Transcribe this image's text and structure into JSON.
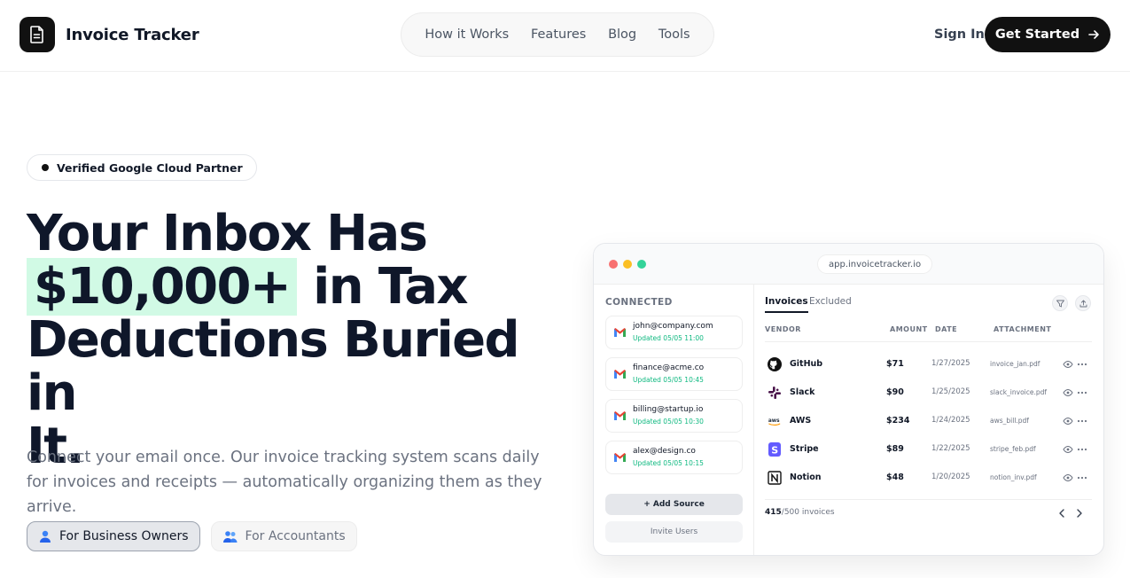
{
  "brand": {
    "name": "Invoice Tracker",
    "icon": "document-icon"
  },
  "nav": {
    "items": [
      "How it Works",
      "Features",
      "Blog",
      "Tools"
    ]
  },
  "header": {
    "sign_in": "Sign In",
    "cta": "Get Started",
    "cta_icon": "arrow-right-icon"
  },
  "hero": {
    "badge": "Verified Google Cloud Partner",
    "headline_1": "Your Inbox Has",
    "headline_highlight": "$10,000+",
    "headline_2": "in Tax",
    "headline_3": "Deductions Buried in",
    "headline_4": "It.",
    "subtitle": "Connect your email once. Our invoice tracking system scans daily for invoices and receipts — automatically organizing them as they arrive.",
    "tabs": [
      {
        "label": "For Business Owners",
        "icon": "person-icon",
        "active": true
      },
      {
        "label": "For Accountants",
        "icon": "people-icon",
        "active": false
      }
    ],
    "highlight_color": "#d1fae5"
  },
  "app": {
    "url": "app.invoicetracker.io",
    "window_dots": [
      "#f87171",
      "#fbbf24",
      "#34d399"
    ],
    "sidebar": {
      "title": "CONNECTED",
      "accounts": [
        {
          "email": "john@company.com",
          "updated": "Updated 05/05 11:00"
        },
        {
          "email": "finance@acme.co",
          "updated": "Updated 05/05 10:45"
        },
        {
          "email": "billing@startup.io",
          "updated": "Updated 05/05 10:30"
        },
        {
          "email": "alex@design.co",
          "updated": "Updated 05/05 10:15"
        }
      ],
      "add_source": "+ Add Source",
      "invite_users": "Invite Users"
    },
    "main": {
      "tabs": [
        "Invoices",
        "Excluded"
      ],
      "columns": {
        "vendor": "VENDOR",
        "amount": "AMOUNT",
        "date": "DATE",
        "attachment": "ATTACHMENT"
      },
      "rows": [
        {
          "vendor": "GitHub",
          "amount": "$71",
          "date": "1/27/2025",
          "file": "invoice_jan.pdf",
          "logo": "github-icon"
        },
        {
          "vendor": "Slack",
          "amount": "$90",
          "date": "1/25/2025",
          "file": "slack_invoice.pdf",
          "logo": "slack-icon"
        },
        {
          "vendor": "AWS",
          "amount": "$234",
          "date": "1/24/2025",
          "file": "aws_bill.pdf",
          "logo": "aws-icon"
        },
        {
          "vendor": "Stripe",
          "amount": "$89",
          "date": "1/22/2025",
          "file": "stripe_feb.pdf",
          "logo": "stripe-icon"
        },
        {
          "vendor": "Notion",
          "amount": "$48",
          "date": "1/20/2025",
          "file": "notion_inv.pdf",
          "logo": "notion-icon"
        }
      ],
      "count_current": "415",
      "count_total": "/500 invoices"
    }
  }
}
